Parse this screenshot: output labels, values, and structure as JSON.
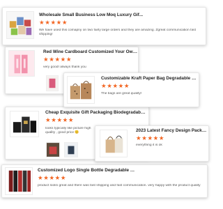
{
  "reviews": [
    {
      "title": "Wholesale Small Business Low Moq Luxury Gif...",
      "rating": 5,
      "text": "We have used this comapny on two fairly large orders and they are amazing. Zgreat communication fast shipping!",
      "thumb_icon": "gift-box-stack-thumbnail"
    },
    {
      "title": "Red Wine Cardboard Customized Your Own Lo...",
      "rating": 5,
      "text": "very good! always thank you",
      "thumb_icon": "wine-box-thumbnail"
    },
    {
      "title": "Customizable Kraft Paper Bag Degradable Pac...",
      "rating": 5,
      "text": "The bags are great quality!",
      "thumb_icon": "kraft-bag-thumbnail"
    },
    {
      "title": "Cheap Exquisite Gift Packaging Biodegradable ...",
      "rating": 5,
      "text": "looks typically like picture high quality , good price",
      "thumb_icon": "black-gift-bag-thumbnail"
    },
    {
      "title": "2023 Latest Fancy Design Packaging ...",
      "rating": 5,
      "text": "everything it is ok",
      "thumb_icon": "fancy-bag-thumbnail"
    },
    {
      "title": "Customized Logo Single Bottle Degradable Car...",
      "rating": 5,
      "text": "product looks great and there was fast shipping and fast communication. very happy with the product quality",
      "thumb_icon": "bottle-box-thumbnail"
    }
  ],
  "emoji": "😊",
  "colors": {
    "star": "#f26522",
    "title": "#222222",
    "review_text": "#555555"
  }
}
